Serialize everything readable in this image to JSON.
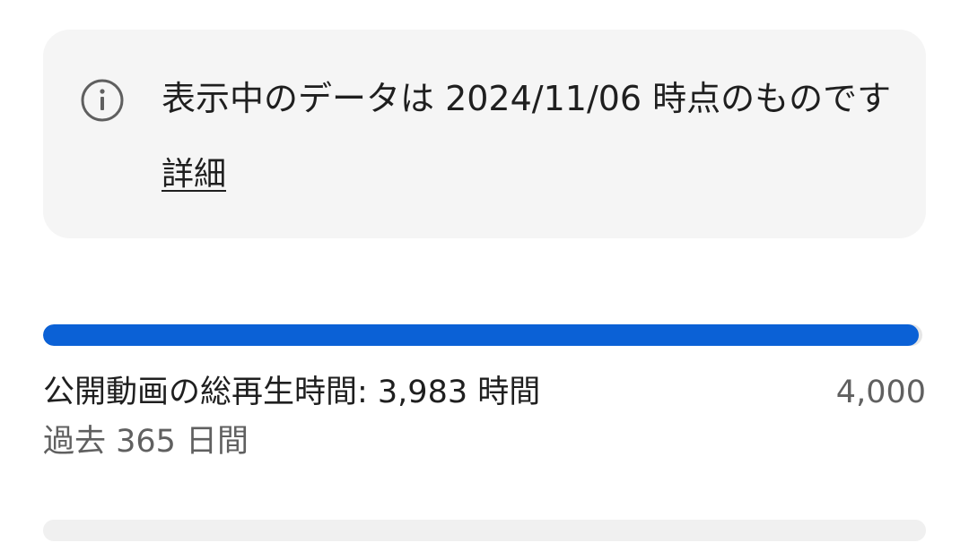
{
  "notice": {
    "icon": "info-icon",
    "text": "表示中のデータは 2024/11/06 時点のものです",
    "link_label": "詳細"
  },
  "metric": {
    "label": "公開動画の総再生時間: 3,983 時間",
    "target": "4,000",
    "period": "過去 365 日間",
    "current": 3983,
    "goal": 4000,
    "progress_fraction": 0.99575
  },
  "colors": {
    "accent": "#0b61d6",
    "card_background": "#f5f5f5",
    "secondary_text": "#606060"
  }
}
